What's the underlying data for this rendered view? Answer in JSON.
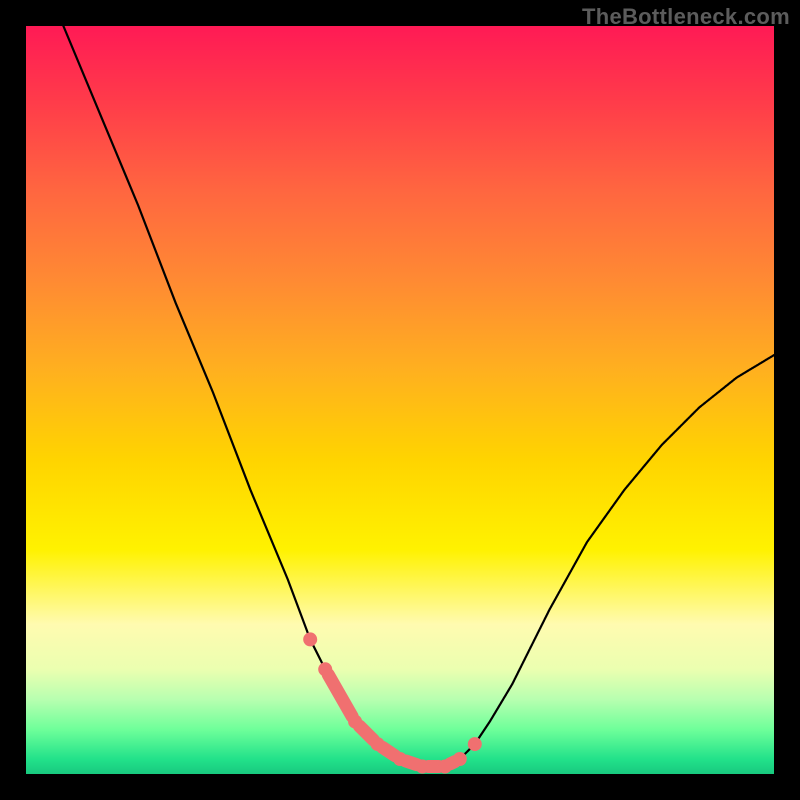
{
  "watermark": "TheBottleneck.com",
  "colors": {
    "background": "#000000",
    "gradient_top": "#ff1a55",
    "gradient_bottom": "#18c97f",
    "curve": "#000000",
    "marker": "#f07070"
  },
  "chart_data": {
    "type": "line",
    "title": "",
    "xlabel": "",
    "ylabel": "",
    "xlim": [
      0,
      100
    ],
    "ylim": [
      0,
      100
    ],
    "grid": false,
    "series": [
      {
        "name": "curve-left",
        "style": "solid",
        "x": [
          5,
          10,
          15,
          20,
          25,
          30,
          35,
          38,
          40,
          42,
          44,
          46,
          48,
          50,
          52,
          54,
          56
        ],
        "values": [
          100,
          88,
          76,
          63,
          51,
          38,
          26,
          18,
          14,
          10,
          7,
          5,
          3,
          2,
          1,
          1,
          1
        ]
      },
      {
        "name": "curve-right",
        "style": "dotted",
        "x": [
          56,
          58,
          60,
          62,
          65,
          70,
          75,
          80,
          85,
          90,
          95,
          100
        ],
        "values": [
          1,
          2,
          4,
          7,
          12,
          22,
          31,
          38,
          44,
          49,
          53,
          56
        ]
      }
    ],
    "markers": {
      "name": "highlight-points",
      "x": [
        38,
        40,
        44,
        47,
        50,
        53,
        56,
        58,
        60
      ],
      "values": [
        18,
        14,
        7,
        4,
        2,
        1,
        1,
        2,
        4
      ]
    }
  }
}
